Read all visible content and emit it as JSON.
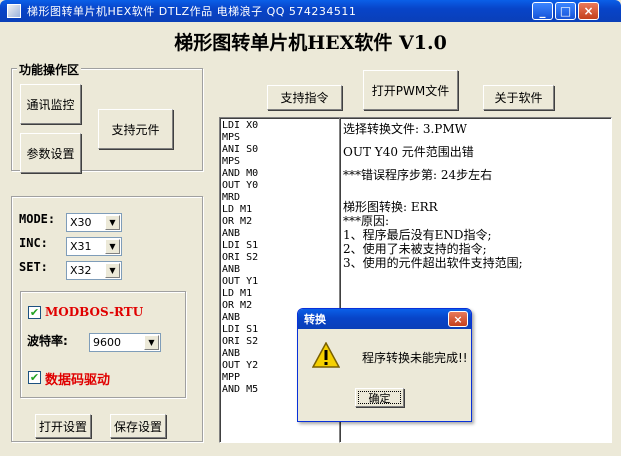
{
  "window": {
    "title": "梯形图转单片机HEX软件   DTLZ作品   电梯浪子  QQ 574234511",
    "minimize": "_",
    "maximize": "□",
    "close": "×"
  },
  "heading": "梯形图转单片机HEX软件  V1.0",
  "function_area": {
    "label": "功能操作区",
    "comm_monitor": "通讯监控",
    "support_component": "支持元件",
    "param_settings": "参数设置"
  },
  "io_settings": {
    "mode_label": "MODE:",
    "mode_value": "X30",
    "inc_label": "INC:",
    "inc_value": "X31",
    "set_label": "SET:",
    "set_value": "X32"
  },
  "modbus": {
    "checkbox_label": "MODBOS-RTU",
    "baud_label": "波特率:",
    "baud_value": "9600",
    "digit_driver_label": "数据码驱动"
  },
  "bottom_buttons": {
    "open_settings": "打开设置",
    "save_settings": "保存设置"
  },
  "top_buttons": {
    "support_instructions": "支持指令",
    "open_pwm_file": "打开PWM文件",
    "about": "关于软件"
  },
  "code_lines": [
    "LDI X0",
    "MPS",
    "ANI S0",
    "MPS",
    "AND M0",
    "OUT Y0",
    "MRD",
    "LD M1",
    "OR M2",
    "ANB",
    "LDI S1",
    "ORI S2",
    "ANB",
    "OUT Y1",
    "LD M1",
    "OR M2",
    "ANB",
    "LDI S1",
    "ORI S2",
    "ANB",
    "OUT Y2",
    "MPP",
    "AND M5"
  ],
  "output_lines": [
    "选择转换文件: 3.PMW",
    "",
    "OUT Y40 元件范围出错",
    "",
    "***错误程序步第: 24步左右",
    "",
    "",
    "梯形图转换: ERR",
    "***原因:",
    "1、程序最后没有END指令;",
    "2、使用了未被支持的指令;",
    "3、使用的元件超出软件支持范围;"
  ],
  "dialog": {
    "title": "转换",
    "close": "×",
    "message": "程序转换未能完成!!",
    "ok": "确定",
    "icon": "warning-icon"
  }
}
